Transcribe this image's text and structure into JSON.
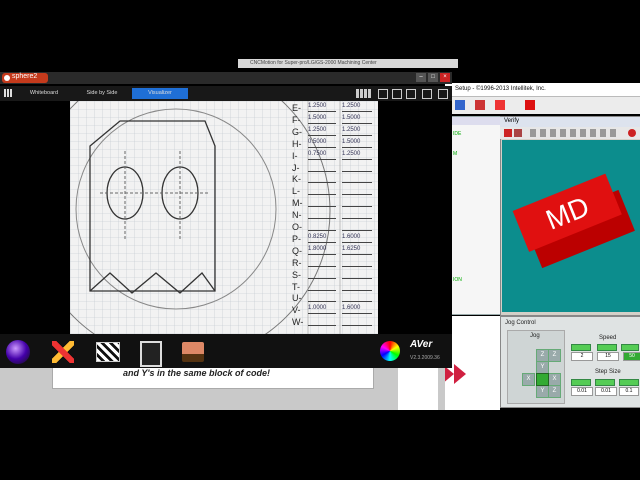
{
  "background_window": {
    "title": "CNCMotion for Super-pro/LG/GS-2000 Machining Center",
    "setup_text": "Setup - ©1996-2013 Intellitek, Inc.",
    "left_labels": [
      "IDE",
      "M",
      "ION"
    ]
  },
  "verify": {
    "title": "Verify",
    "logo_text": "MD",
    "colors": {
      "canvas": "#0c8d8d",
      "logo": "#e01010"
    }
  },
  "jog_control": {
    "title": "Jog Control",
    "jog_label": "Jog",
    "speed_label": "Speed",
    "speed_values": [
      "2",
      "15",
      "50"
    ],
    "step_size_label": "Step Size",
    "step_values": [
      "0.01",
      "0.01",
      "0.1"
    ],
    "axis_buttons": [
      "Z",
      "Z",
      "Y",
      "X",
      "X",
      "Y",
      "Z"
    ]
  },
  "document": {
    "visible_text": "and Y's in the same block of code!"
  },
  "sphere2": {
    "app_name": "sphere2",
    "tabs": [
      {
        "label": "Whiteboard",
        "active": false
      },
      {
        "label": "Side by Side",
        "active": false
      },
      {
        "label": "Visualizer",
        "active": true
      }
    ],
    "brand": "AVer",
    "version": "V2.3.2009.36",
    "dock_icons": [
      "sphere-icon",
      "tools-icon",
      "clapper-icon",
      "copy-icon",
      "presenter-icon",
      "color-wheel-icon"
    ]
  },
  "paper_sheet": {
    "letters": [
      "E",
      "F",
      "G",
      "H",
      "I",
      "J",
      "K",
      "L",
      "M",
      "N",
      "O",
      "P",
      "Q",
      "R",
      "S",
      "T",
      "U",
      "V",
      "W"
    ],
    "col1": [
      "1.2500",
      "1.5000",
      "1.2500",
      "0.5000",
      "0.7500",
      "",
      "",
      "",
      "",
      "",
      "",
      "0.8250",
      "1.8000",
      "",
      "",
      "",
      "",
      "1.0000",
      ""
    ],
    "col2": [
      "1.2500",
      "1.5000",
      "1.2500",
      "1.5000",
      "1.2500",
      "",
      "",
      "",
      "",
      "",
      "",
      "1.6000",
      "1.6250",
      "",
      "",
      "",
      "",
      "1.6000",
      ""
    ]
  }
}
